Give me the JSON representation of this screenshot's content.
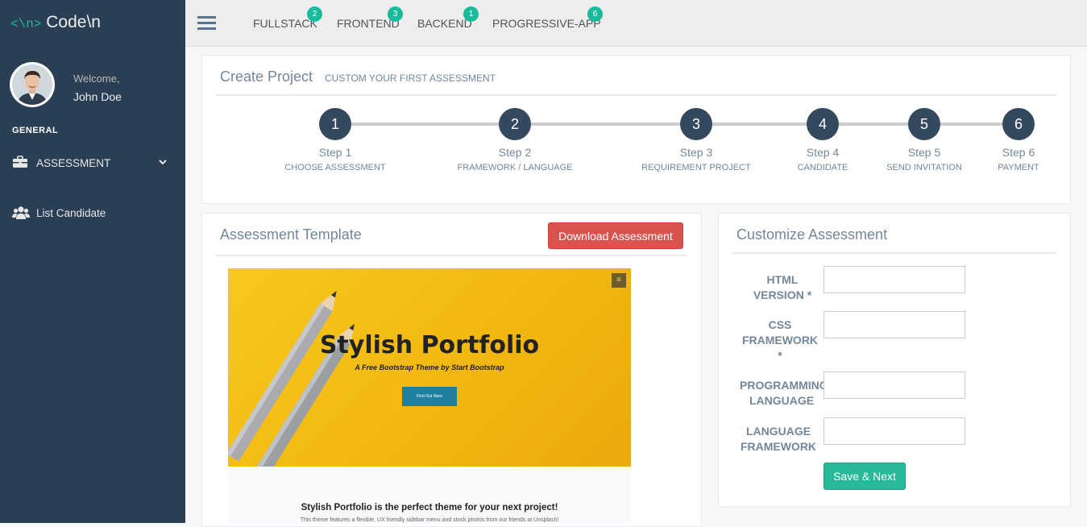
{
  "brand": {
    "open": "<\\n>",
    "name": "Code\\n"
  },
  "profile": {
    "welcome": "Welcome,",
    "name": "John Doe"
  },
  "sidebar": {
    "section": "GENERAL",
    "items": [
      {
        "label": "ASSESSMENT",
        "icon": "briefcase-icon"
      },
      {
        "label": "List Candidate",
        "icon": "users-icon"
      }
    ]
  },
  "topnav": {
    "tabs": [
      {
        "label": "FULLSTACK",
        "badge": "2"
      },
      {
        "label": "FRONTEND",
        "badge": "3"
      },
      {
        "label": "BACKEND",
        "badge": "1"
      },
      {
        "label": "PROGRESSIVE-APP",
        "badge": "6"
      }
    ]
  },
  "create_project": {
    "title": "Create Project",
    "subtitle": "CUSTOM YOUR FIRST ASSESSMENT",
    "steps": [
      {
        "num": "1",
        "step": "Step 1",
        "label": "CHOOSE ASSESSMENT"
      },
      {
        "num": "2",
        "step": "Step 2",
        "label": "FRAMEWORK / LANGUAGE"
      },
      {
        "num": "3",
        "step": "Step 3",
        "label": "REQUIREMENT PROJECT"
      },
      {
        "num": "4",
        "step": "Step 4",
        "label": "CANDIDATE"
      },
      {
        "num": "5",
        "step": "Step 5",
        "label": "SEND INVITATION"
      },
      {
        "num": "6",
        "step": "Step 6",
        "label": "PAYMENT"
      }
    ]
  },
  "template_panel": {
    "title": "Assessment Template",
    "download_label": "Download Assessment",
    "preview": {
      "menu": "≡",
      "heading": "Stylish Portfolio",
      "tagline": "A Free Bootstrap Theme by Start Bootstrap",
      "button": "Find Out More",
      "section_title": "Stylish Portfolio is the perfect theme for your next project!",
      "section_text": "This theme features a flexible, UX friendly sidebar menu and stock photos from our friends at Unsplash!"
    }
  },
  "customize_panel": {
    "title": "Customize Assessment",
    "fields": [
      {
        "label": "HTML VERSION *",
        "value": ""
      },
      {
        "label": "CSS FRAMEWORK *",
        "value": ""
      },
      {
        "label": "PROGRAMMING LANGUAGE",
        "value": ""
      },
      {
        "label": "LANGUAGE FRAMEWORK",
        "value": ""
      }
    ],
    "submit_label": "Save & Next"
  },
  "colors": {
    "sidebar": "#2A3F54",
    "accent": "#1ABB9C",
    "step_circle": "#34495E",
    "danger": "#D9534F",
    "success": "#26B99A"
  }
}
